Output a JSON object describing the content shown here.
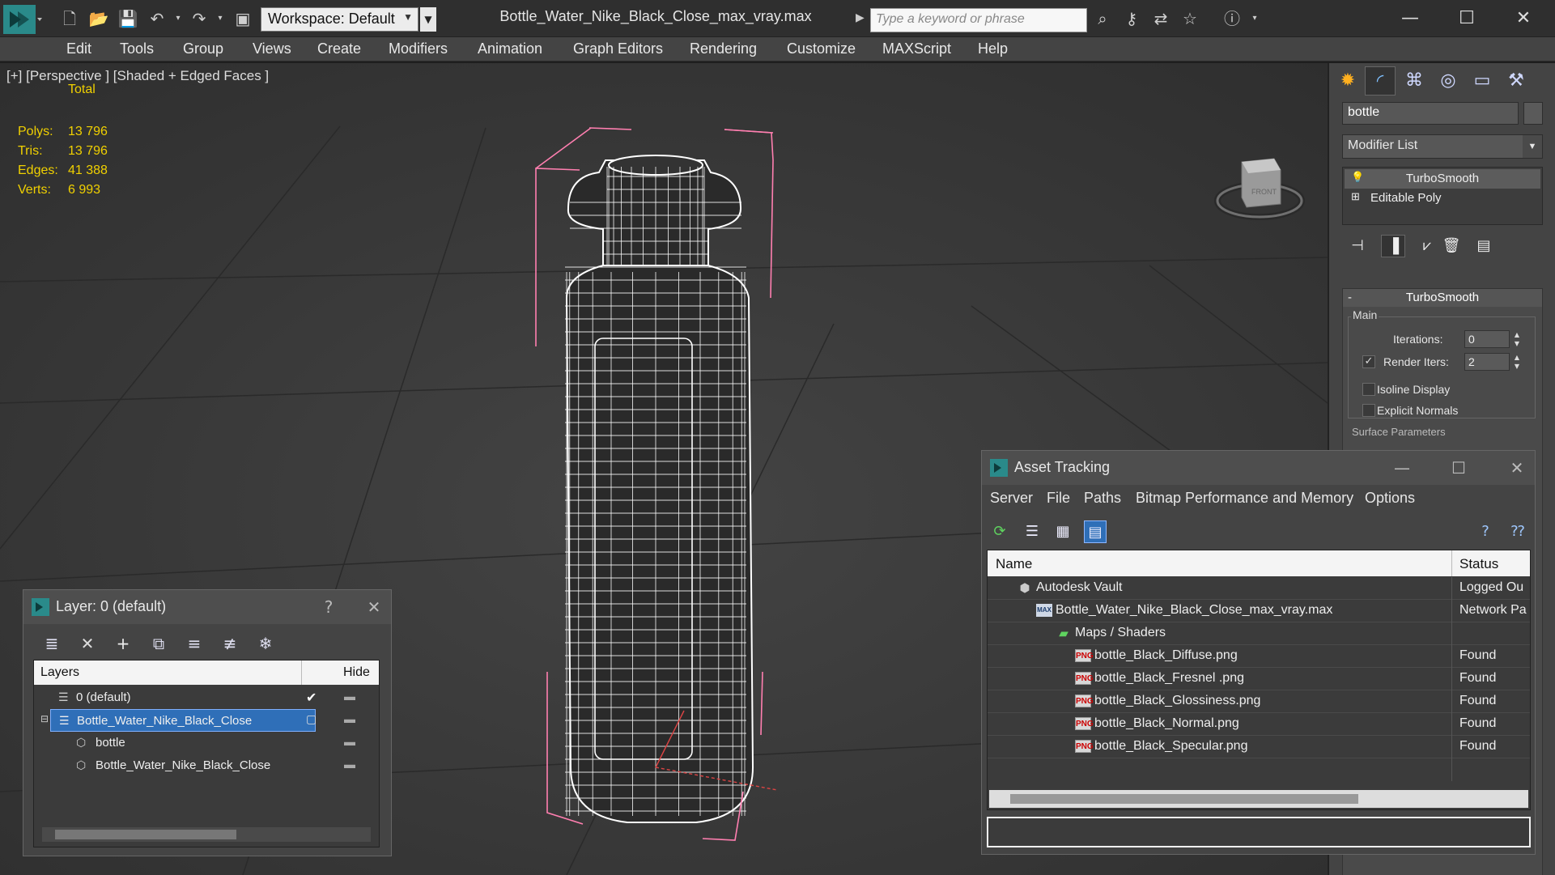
{
  "titlebar": {
    "workspace_label": "Workspace: Default",
    "file_title": "Bottle_Water_Nike_Black_Close_max_vray.max",
    "search_placeholder": "Type a keyword or phrase"
  },
  "menubar": {
    "items": [
      "Edit",
      "Tools",
      "Group",
      "Views",
      "Create",
      "Modifiers",
      "Animation",
      "Graph Editors",
      "Rendering",
      "Customize",
      "MAXScript",
      "Help"
    ]
  },
  "viewport": {
    "label": "[+] [Perspective ] [Shaded + Edged Faces ]",
    "viewcube_face": "FRONT",
    "stats": {
      "total_label": "Total",
      "rows": [
        {
          "label": "Polys:",
          "value": "13 796"
        },
        {
          "label": "Tris:",
          "value": "13 796"
        },
        {
          "label": "Edges:",
          "value": "41 388"
        },
        {
          "label": "Verts:",
          "value": "6 993"
        }
      ]
    }
  },
  "command_panel": {
    "object_name": "bottle",
    "modifier_list": "Modifier List",
    "stack": [
      {
        "name": "TurboSmooth",
        "selected": true
      },
      {
        "name": "Editable Poly",
        "selected": false
      }
    ],
    "turbosmooth": {
      "title": "TurboSmooth",
      "main_label": "Main",
      "iterations_label": "Iterations:",
      "iterations_value": "0",
      "render_iters_label": "Render Iters:",
      "render_iters_value": "2",
      "render_iters_checked": true,
      "isoline_label": "Isoline Display",
      "explicit_normals_label": "Explicit Normals",
      "surface_params_label": "Surface Parameters"
    }
  },
  "layer_dialog": {
    "title": "Layer: 0 (default)",
    "help": "?",
    "col_layers": "Layers",
    "col_hide": "Hide",
    "rows": [
      {
        "name": "0 (default)",
        "indent": 1,
        "checked": true,
        "selected": false
      },
      {
        "name": "Bottle_Water_Nike_Black_Close",
        "indent": 1,
        "checked": false,
        "selected": true
      },
      {
        "name": "bottle",
        "indent": 2,
        "checked": false,
        "selected": false
      },
      {
        "name": "Bottle_Water_Nike_Black_Close",
        "indent": 2,
        "checked": false,
        "selected": false
      }
    ]
  },
  "asset_dialog": {
    "title": "Asset Tracking",
    "menu": [
      "Server",
      "File",
      "Paths",
      "Bitmap Performance and Memory",
      "Options"
    ],
    "col_name": "Name",
    "col_status": "Status",
    "rows": [
      {
        "name": "Autodesk Vault",
        "status": "Logged Ou",
        "indent": 0,
        "icon": "vault-icon"
      },
      {
        "name": "Bottle_Water_Nike_Black_Close_max_vray.max",
        "status": "Network Pa",
        "indent": 1,
        "icon": "max-file-icon"
      },
      {
        "name": "Maps / Shaders",
        "status": "",
        "indent": 2,
        "icon": "maps-folder-icon"
      },
      {
        "name": "bottle_Black_Diffuse.png",
        "status": "Found",
        "indent": 3,
        "icon": "png-icon"
      },
      {
        "name": "bottle_Black_Fresnel .png",
        "status": "Found",
        "indent": 3,
        "icon": "png-icon"
      },
      {
        "name": "bottle_Black_Glossiness.png",
        "status": "Found",
        "indent": 3,
        "icon": "png-icon"
      },
      {
        "name": "bottle_Black_Normal.png",
        "status": "Found",
        "indent": 3,
        "icon": "png-icon"
      },
      {
        "name": "bottle_Black_Specular.png",
        "status": "Found",
        "indent": 3,
        "icon": "png-icon"
      }
    ]
  },
  "colors": {
    "stats_yellow": "#f0d000",
    "selection_blue": "#2f6fb8",
    "bbox_pink": "#ff7fb0",
    "wireframe": "#ffffff"
  }
}
